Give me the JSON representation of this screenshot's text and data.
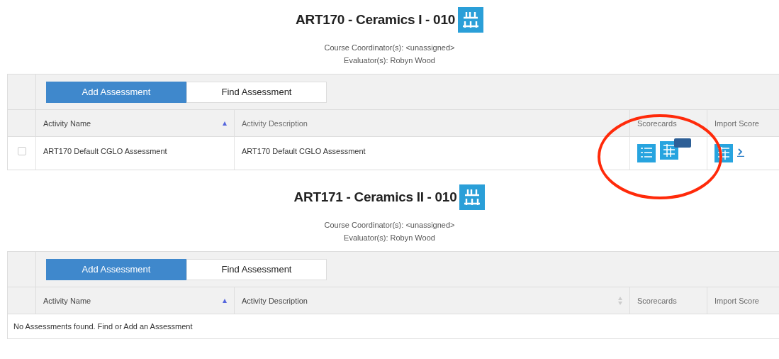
{
  "courses": [
    {
      "title": "ART170 - Ceramics I - 010",
      "coordinators": "Course Coordinator(s): <unassigned>",
      "evaluators": "Evaluator(s): Robyn Wood",
      "actions": [
        {
          "label": "Add Assessment",
          "selected": true
        },
        {
          "label": "Find Assessment",
          "selected": false
        }
      ],
      "columns": [
        {
          "label": "Activity Name",
          "sorted": true,
          "sortable": true
        },
        {
          "label": "Activity Description",
          "sorted": false,
          "sortable": false
        },
        {
          "label": "Scorecards",
          "sorted": false,
          "sortable": false
        },
        {
          "label": "Import Score",
          "sorted": false,
          "sortable": false
        }
      ],
      "rows": [
        {
          "checked": false,
          "name": "ART170 Default CGLO Assessment",
          "description": "ART170 Default CGLO Assessment"
        }
      ]
    },
    {
      "title": "ART171 - Ceramics II - 010",
      "coordinators": "Course Coordinator(s): <unassigned>",
      "evaluators": "Evaluator(s): Robyn Wood",
      "actions": [
        {
          "label": "Add Assessment",
          "selected": true
        },
        {
          "label": "Find Assessment",
          "selected": false
        }
      ],
      "columns": [
        {
          "label": "Activity Name",
          "sorted": true,
          "sortable": true
        },
        {
          "label": "Activity Description",
          "sorted": false,
          "sortable": true
        },
        {
          "label": "Scorecards",
          "sorted": false,
          "sortable": false
        },
        {
          "label": "Import Score",
          "sorted": false,
          "sortable": false
        }
      ],
      "empty_message": "No Assessments found. Find or Add an Assessment"
    }
  ]
}
